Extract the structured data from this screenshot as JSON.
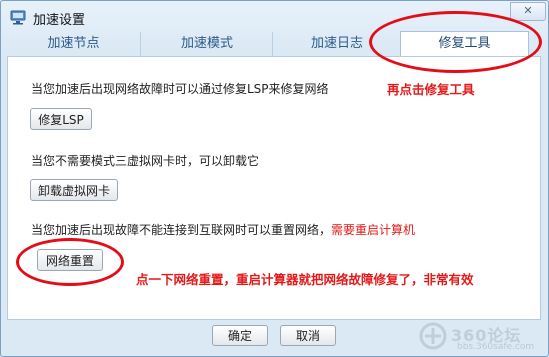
{
  "window": {
    "title": "加速设置",
    "close_symbol": "✕"
  },
  "tabs": [
    {
      "label": "加速节点"
    },
    {
      "label": "加速模式"
    },
    {
      "label": "加速日志"
    },
    {
      "label": "修复工具",
      "active": true
    }
  ],
  "sections": {
    "lsp": {
      "text": "当您加速后出现网络故障时可以通过修复LSP来修复网络",
      "button": "修复LSP"
    },
    "vnic": {
      "text": "当您不需要模式三虚拟网卡时，可以卸载它",
      "button": "卸载虚拟网卡"
    },
    "reset": {
      "text": "当您加速后出现故障不能连接到互联网时可以重置网络，",
      "warning": "需要重启计算机",
      "button": "网络重置"
    }
  },
  "annotations": {
    "click_tool": "再点击修复工具",
    "reset_hint": "点一下网络重置，重启计算器就把网络故障修复了，非常有效"
  },
  "footer": {
    "ok": "确定",
    "cancel": "取消"
  },
  "watermark": {
    "brand": "360论坛",
    "url": "bbs.360safe.com"
  },
  "colors": {
    "annotation_red": "#e41a1a",
    "tab_text": "#2c5a86",
    "accent_blue": "#7d9fc0"
  }
}
